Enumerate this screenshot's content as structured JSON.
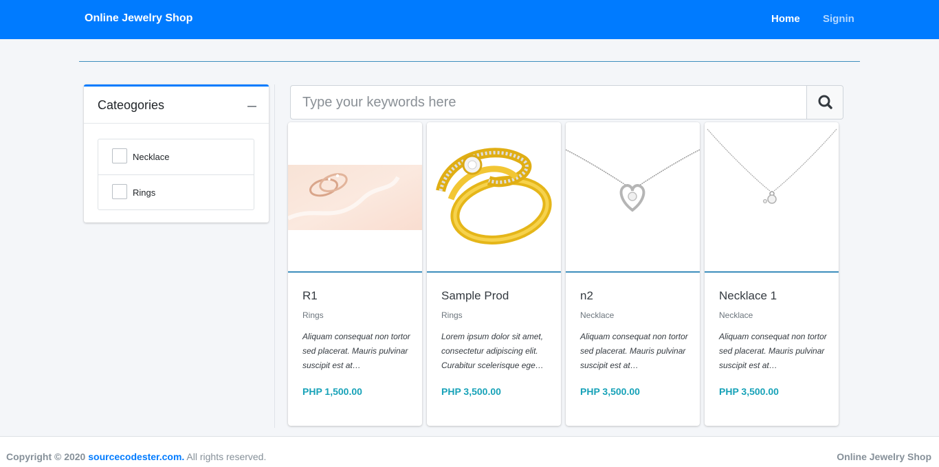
{
  "navbar": {
    "brand": "Online Jewelry Shop",
    "links": [
      {
        "label": "Home"
      },
      {
        "label": "Signin"
      }
    ]
  },
  "categories": {
    "title": "Cateogories",
    "items": [
      {
        "label": "Necklace",
        "checked": false
      },
      {
        "label": "Rings",
        "checked": false
      }
    ]
  },
  "search": {
    "placeholder": "Type your keywords here",
    "value": ""
  },
  "products": [
    {
      "name": "R1",
      "category": "Rings",
      "description": "Aliquam consequat non tortor sed placerat. Mauris pulvinar suscipit est at…",
      "price": "PHP 1,500.00",
      "image_icon": "rose-gold-rings-image"
    },
    {
      "name": "Sample Prod",
      "category": "Rings",
      "description": "Lorem ipsum dolor sit amet, consectetur adipiscing elit. Curabitur scelerisque ege…",
      "price": "PHP 3,500.00",
      "image_icon": "gold-diamond-ring-image"
    },
    {
      "name": "n2",
      "category": "Necklace",
      "description": "Aliquam consequat non tortor sed placerat. Mauris pulvinar suscipit est at…",
      "price": "PHP 3,500.00",
      "image_icon": "heart-pendant-necklace-image"
    },
    {
      "name": "Necklace 1",
      "category": "Necklace",
      "description": "Aliquam consequat non tortor sed placerat. Mauris pulvinar suscipit est at…",
      "price": "PHP 3,500.00",
      "image_icon": "diamond-pendant-necklace-image"
    }
  ],
  "footer": {
    "copyright_prefix": "Copyright © 2020",
    "link_text": "sourcecodester.com.",
    "suffix": "All rights reserved.",
    "right_text": "Online Jewelry Shop"
  },
  "colors": {
    "primary": "#007bff",
    "price": "#17a2b8",
    "accent_line": "#3c8dbc"
  }
}
